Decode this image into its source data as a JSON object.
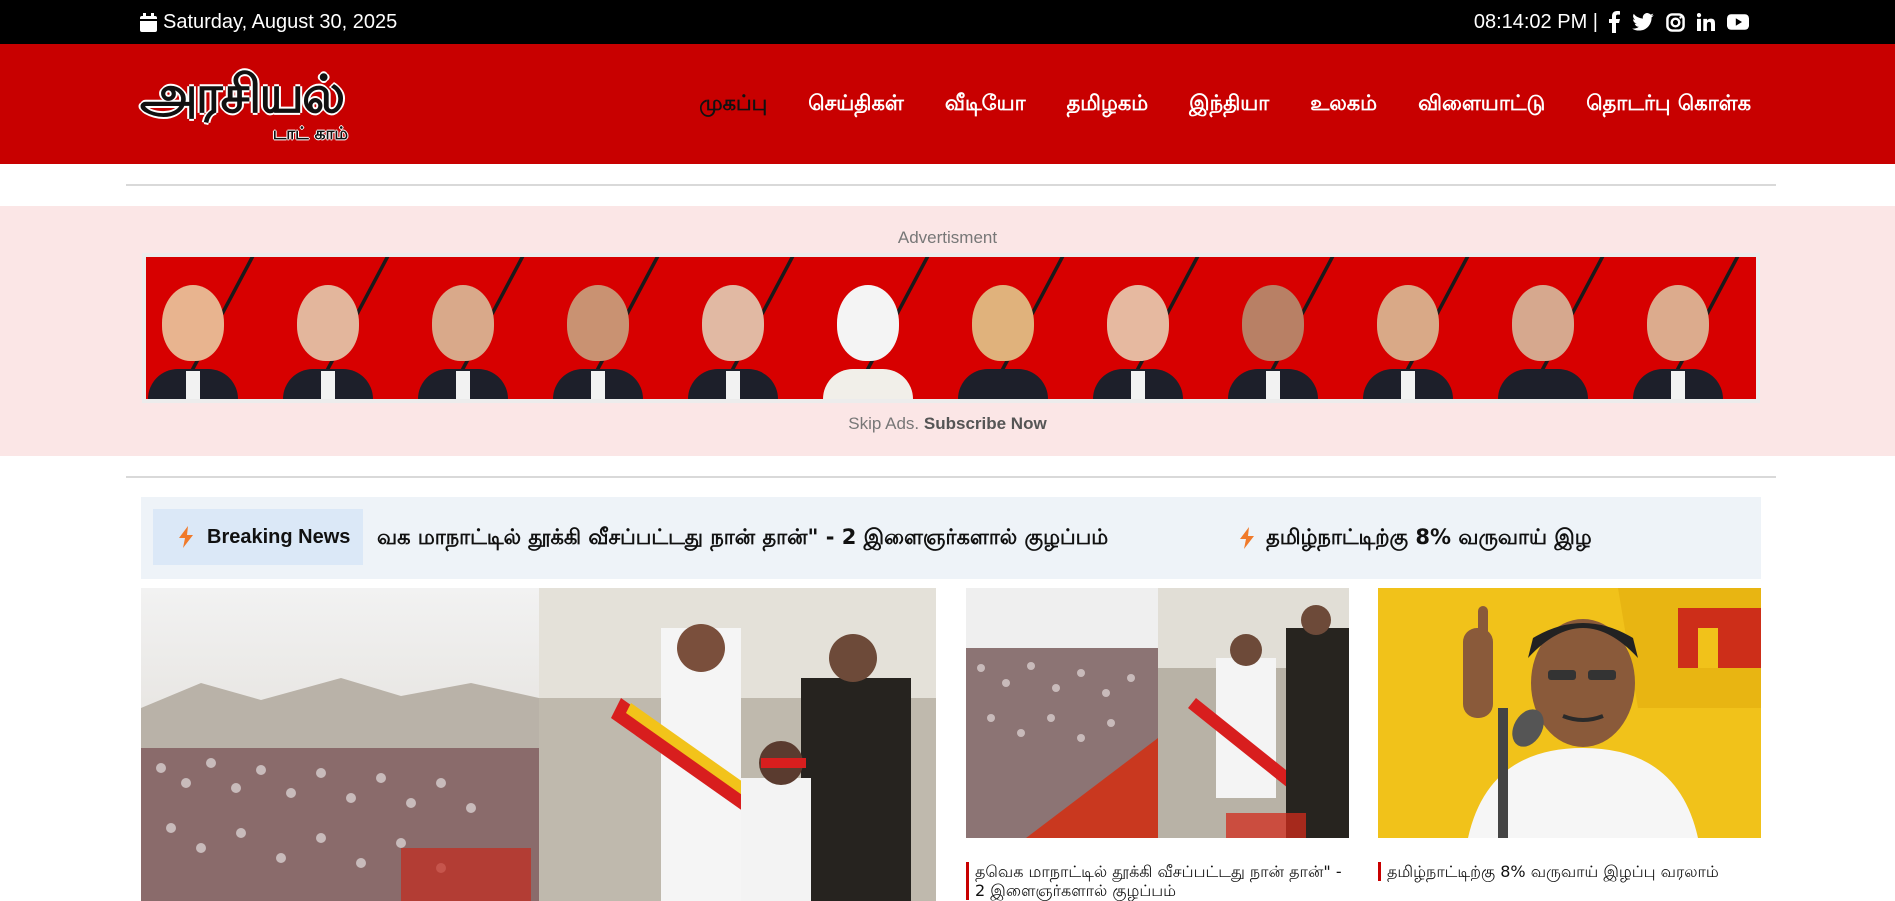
{
  "topbar": {
    "date": "Saturday, August 30, 2025",
    "time": "08:14:02 PM |",
    "social": [
      "facebook-icon",
      "twitter-icon",
      "instagram-icon",
      "linkedin-icon",
      "youtube-icon"
    ]
  },
  "header": {
    "logo_main": "அரசியல்",
    "logo_sub": "டாட் காம்",
    "nav": [
      "முகப்பு",
      "செய்திகள்",
      "வீடியோ",
      "தமிழகம்",
      "இந்தியா",
      "உலகம்",
      "விளையாட்டு",
      "தொடர்பு கொள்க"
    ],
    "active_nav": "முகப்பு"
  },
  "ad": {
    "label": "Advertisment",
    "skip_text": "Skip Ads.",
    "subscribe": "Subscribe Now"
  },
  "breaking": {
    "label": "Breaking News",
    "items": [
      "வக மாநாட்டில் தூக்கி வீசப்பட்டது நான் தான்\" - 2 இளைஞர்களால் குழப்பம்",
      "தமிழ்நாட்டிற்கு 8% வருவாய் இழ"
    ]
  },
  "news": {
    "cards": [
      {
        "title": "தவெக மாநாட்டில் தூக்கி வீசப்பட்டது நான் தான்\" - 2 இளைஞர்களால் குழப்பம்"
      },
      {
        "title": "தமிழ்நாட்டிற்கு 8% வருவாய் இழப்பு வரலாம்"
      }
    ]
  },
  "colors": {
    "header_red": "#c80000",
    "topbar_black": "#000000",
    "ad_bg": "#fbe6e6",
    "breaking_bg": "#eef3f8",
    "bolt_orange": "#f07a2a"
  }
}
